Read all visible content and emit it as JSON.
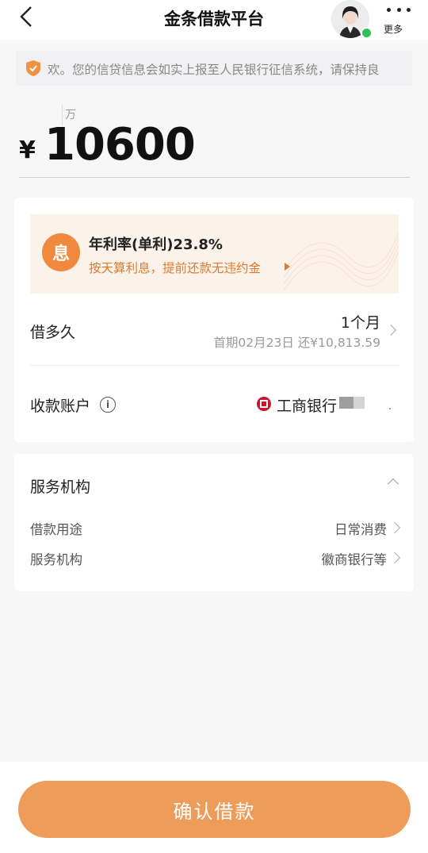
{
  "header": {
    "title": "金条借款平台",
    "more_label": "更多"
  },
  "notice": {
    "text": "欢。您的信贷信息会如实上报至人民银行征信系统，请保持良"
  },
  "amount": {
    "unit": "万",
    "currency": "¥",
    "value": "10600"
  },
  "rate": {
    "badge": "息",
    "title": "年利率(单利)23.8%",
    "subtitle": "按天算利息，提前还款无违约金"
  },
  "duration": {
    "label": "借多久",
    "value": "1个月",
    "first_repayment": "首期02月23日 还¥10,813.59"
  },
  "account": {
    "label": "收款账户",
    "info_icon": "i",
    "bank": "工商银行"
  },
  "service": {
    "title": "服务机构",
    "items": [
      {
        "label": "借款用途",
        "value": "日常消费"
      },
      {
        "label": "服务机构",
        "value": "徽商银行等"
      }
    ]
  },
  "actions": {
    "confirm_label": "确认借款"
  },
  "colors": {
    "accent": "#ed9c5a",
    "rate_text": "#e07a2e",
    "online": "#2fc15a"
  }
}
